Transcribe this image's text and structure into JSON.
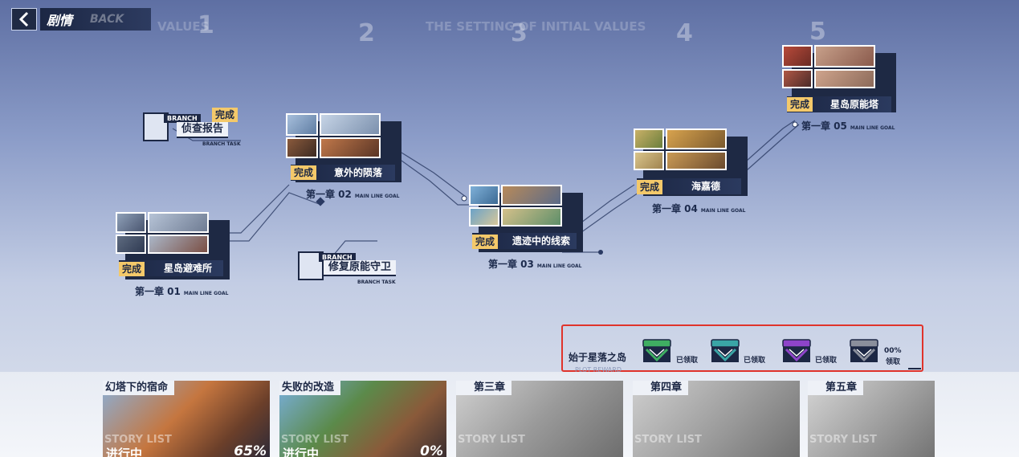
{
  "header": {
    "title": "剧情",
    "back_watermark": "BACK"
  },
  "background": {
    "watermark_top": "THE SETTING OF INITIAL VALUES",
    "watermark_values": "VALUES",
    "big_numbers": [
      "1",
      "2",
      "3",
      "4",
      "5"
    ]
  },
  "chapters": [
    {
      "status": "完成",
      "name": "星岛避难所",
      "number": "第一章 01",
      "goal": "MAIN LINE GOAL"
    },
    {
      "status": "完成",
      "name": "意外的陨落",
      "number": "第一章 02",
      "goal": "MAIN LINE GOAL"
    },
    {
      "status": "完成",
      "name": "遗迹中的线索",
      "number": "第一章 03",
      "goal": "MAIN LINE GOAL"
    },
    {
      "status": "完成",
      "name": "海嘉德",
      "number": "第一章 04",
      "goal": "MAIN LINE GOAL"
    },
    {
      "status": "完成",
      "name": "星岛原能塔",
      "number": "第一章 05",
      "goal": "MAIN LINE GOAL"
    }
  ],
  "branches": [
    {
      "tag": "BRANCH",
      "name": "侦查报告",
      "sub": "BRANCH TASK",
      "status": "完成"
    },
    {
      "tag": "BRANCH",
      "name": "修复原能守卫",
      "sub": "BRANCH TASK"
    }
  ],
  "reward": {
    "title": "始于星落之岛",
    "subtitle": "PLOT REWARD",
    "chests": [
      {
        "label": "已领取",
        "color": "#3fae62"
      },
      {
        "label": "已领取",
        "color": "#3aa5a6"
      },
      {
        "label": "已领取",
        "color": "#8e44c9"
      },
      {
        "label_top": "00%",
        "label_bottom": "领取",
        "color": "#8a8f9c"
      }
    ]
  },
  "stories": [
    {
      "title": "幻塔下的宿命",
      "watermark": "STORY LIST",
      "status": "进行中",
      "percent": "65%",
      "locked": false
    },
    {
      "title": "失败的改造",
      "watermark": "STORY LIST",
      "status": "进行中",
      "percent": "0%",
      "locked": false
    },
    {
      "title": "第三章",
      "watermark": "STORY LIST",
      "locked": true
    },
    {
      "title": "第四章",
      "watermark": "STORY LIST",
      "locked": true
    },
    {
      "title": "第五章",
      "watermark": "STORY LIST",
      "locked": true
    }
  ]
}
